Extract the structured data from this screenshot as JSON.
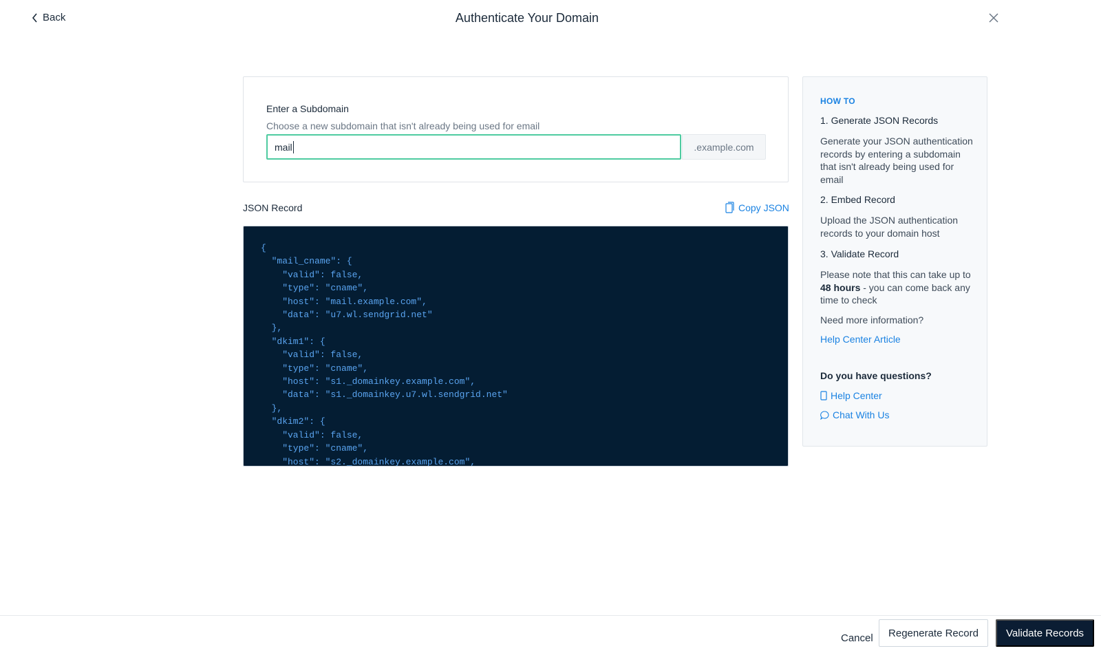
{
  "header": {
    "back_label": "Back",
    "title": "Authenticate Your Domain"
  },
  "subdomain": {
    "label": "Enter a Subdomain",
    "help": "Choose a new subdomain that isn't already being used for email",
    "value": "mail",
    "suffix": ".example.com"
  },
  "json_record": {
    "label": "JSON Record",
    "copy_label": "Copy JSON",
    "code": "{\n  \"mail_cname\": {\n    \"valid\": false,\n    \"type\": \"cname\",\n    \"host\": \"mail.example.com\",\n    \"data\": \"u7.wl.sendgrid.net\"\n  },\n  \"dkim1\": {\n    \"valid\": false,\n    \"type\": \"cname\",\n    \"host\": \"s1._domainkey.example.com\",\n    \"data\": \"s1._domainkey.u7.wl.sendgrid.net\"\n  },\n  \"dkim2\": {\n    \"valid\": false,\n    \"type\": \"cname\",\n    \"host\": \"s2._domainkey.example.com\","
  },
  "sidebar": {
    "heading": "HOW TO",
    "step1_title": "1. Generate JSON Records",
    "step1_body": "Generate your JSON authentication records by entering a subdomain that isn't already being used for email",
    "step2_title": "2. Embed Record",
    "step2_body": "Upload the JSON authentication records to your domain host",
    "step3_title": "3. Validate Record",
    "step3_body_pre": "Please note that this can take up to ",
    "step3_body_bold": "48 hours",
    "step3_body_post": " - you can come back any time to check",
    "more_info": "Need more information?",
    "help_article": "Help Center Article",
    "questions": "Do you have questions?",
    "help_center": "Help Center",
    "chat": "Chat With Us"
  },
  "footer": {
    "cancel": "Cancel",
    "regenerate": "Regenerate Record",
    "validate": "Validate Records"
  },
  "colors": {
    "accent": "#1a82e2",
    "input_focus": "#4ecba0",
    "code_bg": "#041d33",
    "primary_button": "#0b1d33"
  }
}
